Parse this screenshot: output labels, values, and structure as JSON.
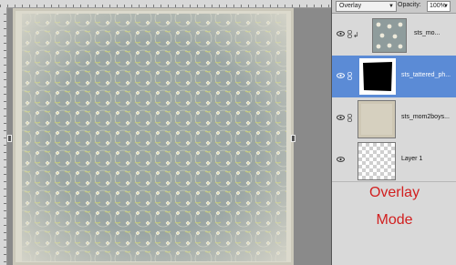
{
  "rulers": {
    "top_end_label": "",
    "right_mark": ""
  },
  "layers_panel": {
    "blend_mode": "Overlay",
    "opacity_label": "Opacity:",
    "opacity_value": "100%",
    "layers": [
      {
        "name": "sts_mo...",
        "selected": false,
        "clipped": true
      },
      {
        "name": "sts_tattered_ph...",
        "selected": true,
        "clipped": false
      },
      {
        "name": "sts_mom2boys...",
        "selected": false,
        "clipped": false
      },
      {
        "name": "Layer 1",
        "selected": false,
        "clipped": false
      }
    ]
  },
  "annotation": {
    "line1": "Overlay",
    "line2": "Mode",
    "color": "#d21f1f"
  },
  "colors": {
    "selected_layer": "#5b8bd6",
    "panel_bg": "#d9d9d9"
  },
  "icons": {
    "visibility": "eye-icon",
    "link": "link-icon",
    "dropdown": "chevron-down-icon"
  }
}
